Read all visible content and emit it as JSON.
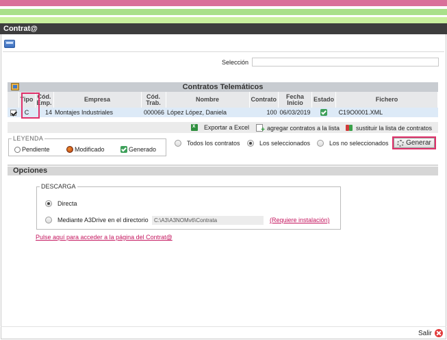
{
  "app": {
    "title": "Contrat@"
  },
  "selection": {
    "label": "Selección",
    "value": ""
  },
  "grid": {
    "title": "Contratos Telemáticos",
    "columns": [
      "",
      "Tipo",
      "Cód. Emp.",
      "Empresa",
      "Cód. Trab.",
      "Nombre",
      "Contrato",
      "Fecha Inicio",
      "Estado",
      "Fichero"
    ],
    "rows": [
      {
        "checked": true,
        "tipo": "C",
        "cod_emp": "14",
        "empresa": "Montajes Industriales",
        "cod_trab": "000066",
        "nombre": "López López, Daniela",
        "contrato": "100",
        "fecha_inicio": "06/03/2019",
        "estado": "generado",
        "fichero": "C19O0001.XML"
      }
    ]
  },
  "actions": {
    "export_excel": "Exportar a Excel",
    "add_contracts": "agregar contratos a la lista",
    "replace_list": "sustituir la lista de contratos"
  },
  "legend": {
    "title": "LEYENDA",
    "pending": "Pendiente",
    "modified": "Modificado",
    "generated": "Generado"
  },
  "filter": {
    "options": [
      "Todos los contratos",
      "Los seleccionados",
      "Los no seleccionados"
    ],
    "selected": "Los seleccionados"
  },
  "generate_button": "Generar",
  "options_section": {
    "title": "Opciones",
    "download_legend": "DESCARGA",
    "direct_label": "Directa",
    "a3drive_label": "Mediante A3Drive en el directorio",
    "directory_value": "C:\\A3\\A3NOMv6\\Contrata",
    "install_link": "(Requiere instalación)",
    "selected": "Directa"
  },
  "contrata_link": "Pulse aquí para acceder a la página del Contrat@",
  "footer": {
    "exit": "Salir"
  }
}
